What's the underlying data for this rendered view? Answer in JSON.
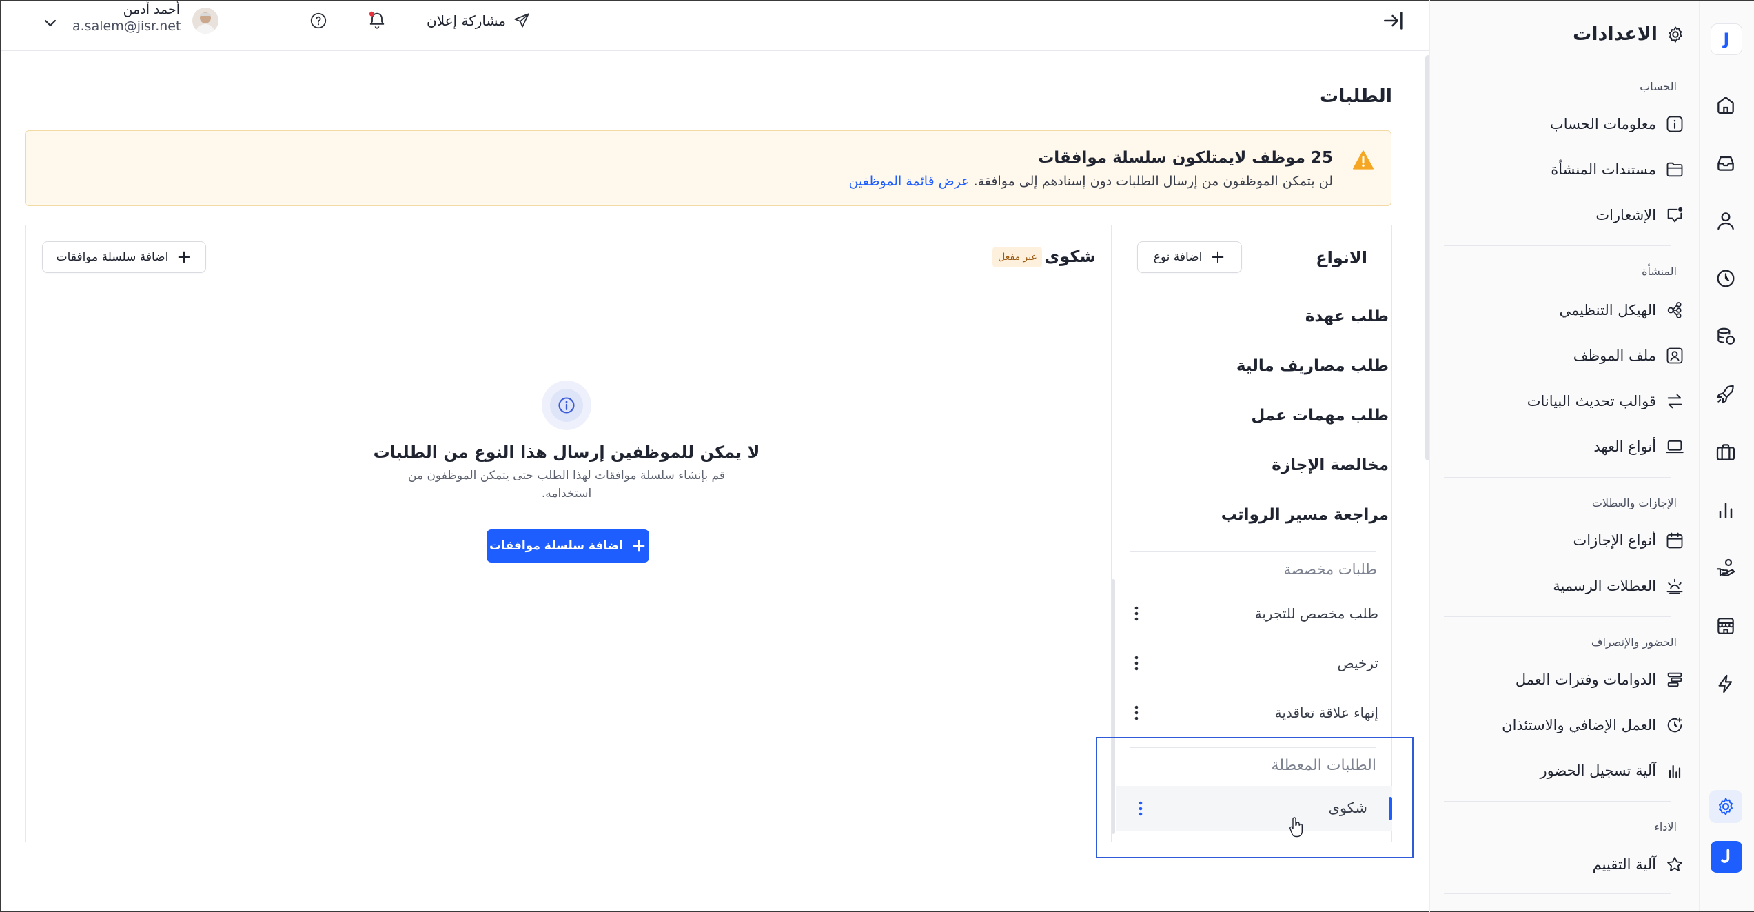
{
  "topbar": {
    "user_name": "أحمد أدمن",
    "user_email": "a.salem@jisr.net",
    "share_announcement": "مشاركة إعلان"
  },
  "page": {
    "title": "الطلبات"
  },
  "warning": {
    "title": "25 موظف لايمتلكون سلسلة موافقات",
    "body": "لن يتمكن الموظفون من إرسال الطلبات دون إسنادهم إلى موافقة.",
    "link": "عرض قائمة الموظفين",
    "color": "#f5a623"
  },
  "types_panel": {
    "title": "الانواع",
    "add_type": "اضافة نوع",
    "items": [
      "طلب عهدة",
      "طلب مصاريف مالية",
      "طلب مهمات عمل",
      "مخالصة الإجازة",
      "مراجعة مسير الرواتب"
    ],
    "custom_heading": "طلبات مخصصة",
    "custom_items": [
      "طلب مخصص للتجربة",
      "ترخيص",
      "إنهاء علاقة تعاقدية"
    ],
    "disabled_heading": "الطلبات المعطلة",
    "disabled_items": [
      "شكوى"
    ]
  },
  "detail_panel": {
    "title": "شكوى",
    "status_badge": "غير مفعل",
    "add_chain": "اضافة سلسلة موافقات",
    "empty_title": "لا يمكن للموظفين إرسال هذا النوع من الطلبات",
    "empty_line1": "قم بإنشاء سلسلة موافقات لهذا الطلب حتى يتمكن الموظفون من",
    "empty_line2": "استخدامه.",
    "primary_button": "اضافة سلسلة موافقات",
    "accent": "#1e5eff"
  },
  "sidebar": {
    "title": "الاعدادات",
    "sections": [
      {
        "label": "الحساب",
        "items": [
          "معلومات الحساب",
          "مستندات المنشأة",
          "الإشعارات"
        ]
      },
      {
        "label": "المنشأة",
        "items": [
          "الهيكل التنظيمي",
          "ملف الموظف",
          "قوالب تحديث البيانات",
          "أنواع العهد"
        ]
      },
      {
        "label": "الإجازات والعطلات",
        "items": [
          "أنواع الإجازات",
          "العطلات الرسمية"
        ]
      },
      {
        "label": "الحضور والإنصراف",
        "items": [
          "الدوامات وفترات العمل",
          "العمل الإضافي والاستئذان",
          "آلية تسجيل الحضور"
        ]
      },
      {
        "label": "الاداء",
        "items": [
          "آلية التقييم"
        ]
      }
    ]
  },
  "rail": {
    "logo": "J",
    "icons": [
      "home-icon",
      "inbox-icon",
      "user-icon",
      "clock-icon",
      "coins-icon",
      "rocket-icon",
      "briefcase-icon",
      "chart-icon",
      "hand-coin-icon",
      "store-icon",
      "bolt-icon",
      "settings-icon"
    ]
  }
}
